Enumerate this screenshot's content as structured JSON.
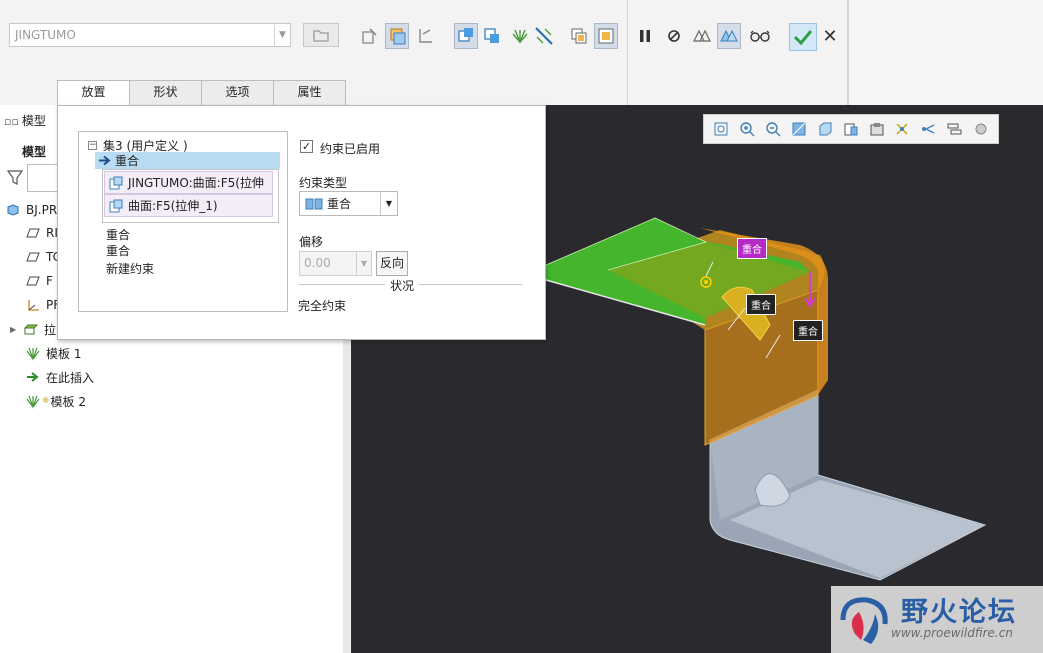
{
  "ribbon": {
    "part_combo_value": "JINGTUMO"
  },
  "tabs": [
    {
      "label": "放置"
    },
    {
      "label": "形状"
    },
    {
      "label": "选项"
    },
    {
      "label": "属性"
    }
  ],
  "tree": {
    "header": "模型树",
    "header_short": "模型",
    "subheader": "模型树",
    "items": [
      {
        "label": "BJ.PR",
        "icon": "part-icon"
      },
      {
        "label": "RI",
        "icon": "datum-plane-icon"
      },
      {
        "label": "TC",
        "icon": "datum-plane-icon"
      },
      {
        "label": "F",
        "icon": "datum-plane-icon"
      },
      {
        "label": "PF",
        "icon": "csys-icon"
      },
      {
        "label": "拉",
        "icon": "extrude-icon"
      },
      {
        "label": "模板 1",
        "icon": "template-icon"
      },
      {
        "label": "在此插入",
        "icon": "insert-arrow-icon"
      },
      {
        "label": "模板 2",
        "icon": "template-icon"
      }
    ]
  },
  "placement": {
    "set_title": "集3 (用户定义 )",
    "selected_constraint": "重合",
    "references": [
      "JINGTUMO:曲面:F5(拉伸",
      "曲面:F5(拉伸_1)"
    ],
    "constraints": [
      "重合",
      "重合",
      "新建约束"
    ],
    "enabled_label": "约束已启用",
    "enabled": true,
    "type_label": "约束类型",
    "type_value": "重合",
    "offset_label": "偏移",
    "offset_value": "0.00",
    "flip_label": "反向",
    "status_label": "状况",
    "status_value": "完全约束"
  },
  "viewport": {
    "tags": [
      "重合",
      "重合",
      "重合"
    ]
  },
  "watermark": {
    "title": "野火论坛",
    "url": "www.proewildfire.cn"
  },
  "colors": {
    "accent": "#1f8fd6",
    "ok_green": "#2aa147",
    "selection": "#b9dcf3",
    "viewport_bg": "#2a2a2e",
    "green_surface": "#44b52c",
    "orange_surface": "#d68a18"
  }
}
